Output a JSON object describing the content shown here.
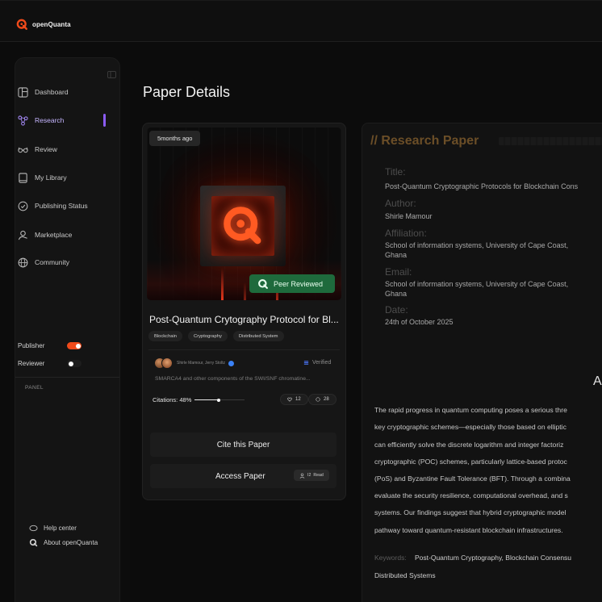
{
  "app": {
    "name": "openQuanta",
    "accent": "#f04a1a"
  },
  "sidebar": {
    "items": [
      {
        "label": "Dashboard",
        "icon": "dashboard-icon"
      },
      {
        "label": "Research",
        "icon": "research-icon",
        "active": true
      },
      {
        "label": "Review",
        "icon": "glasses-icon"
      },
      {
        "label": "My Library",
        "icon": "book-icon"
      },
      {
        "label": "Publishing Status",
        "icon": "check-circle-icon"
      },
      {
        "label": "Marketplace",
        "icon": "marketplace-icon"
      },
      {
        "label": "Community",
        "icon": "globe-icon"
      }
    ],
    "panel_label": "PANEL",
    "toggles": [
      {
        "label": "Publisher",
        "on": true
      },
      {
        "label": "Reviewer",
        "on": false
      }
    ],
    "bottom": [
      {
        "label": "Help center",
        "icon": "help-icon"
      },
      {
        "label": "About openQuanta",
        "icon": "logo-icon"
      }
    ]
  },
  "page": {
    "title": "Paper Details"
  },
  "card": {
    "time_badge": "5months ago",
    "peer_badge": "Peer Reviewed",
    "title": "Post-Quantum Crytography Protocol for Bl...",
    "tags": [
      "Blockchain",
      "Cryptography",
      "Distributed System"
    ],
    "authors": "Shirle Mamour, Jerry Stoltz",
    "verified": "Verified",
    "summary": "SMARCA4 and other components of the SWI/SNF chromatine...",
    "citations_label": "Citations: 48%",
    "citations_progress": 0.48,
    "likes": "12",
    "comments": "28",
    "cite_button": "Cite this Paper",
    "access_button": "Access Paper",
    "read_label": "Read",
    "read_prefix": "I2"
  },
  "paper": {
    "heading": "// Research Paper",
    "title_label": "Title:",
    "title_value": "Post-Quantum Cryptographic Protocols for Blockchain Cons",
    "author_label": "Author:",
    "author_value": "Shirle Mamour",
    "affiliation_label": "Affiliation:",
    "affiliation_value_1": "School of information systems, University of Cape Coast,",
    "affiliation_value_2": "Ghana",
    "email_label": "Email:",
    "email_value_1": "School of information systems, University of Cape Coast,",
    "email_value_2": "Ghana",
    "date_label": "Date:",
    "date_value": "24th of October 2025",
    "abstract_heading": "A",
    "abstract_lines": [
      "The rapid progress in quantum computing poses a serious thre",
      "key cryptographic schemes—especially those based on elliptic",
      "can efficiently solve the discrete logarithm and integer factoriz",
      "cryptographic (POC) schemes, particularly lattice-based protoc",
      "(PoS) and Byzantine Fault Tolerance (BFT). Through a combina",
      "evaluate the security resilience, computational overhead, and s",
      "systems. Our findings suggest that hybrid cryptographic model",
      "pathway toward quantum-resistant blockchain infrastructures."
    ],
    "keywords_label": "Keywords:",
    "keywords_value_1": "Post-Quantum Cryptography, Blockchain Consensu",
    "keywords_value_2": "Distributed Systems"
  }
}
